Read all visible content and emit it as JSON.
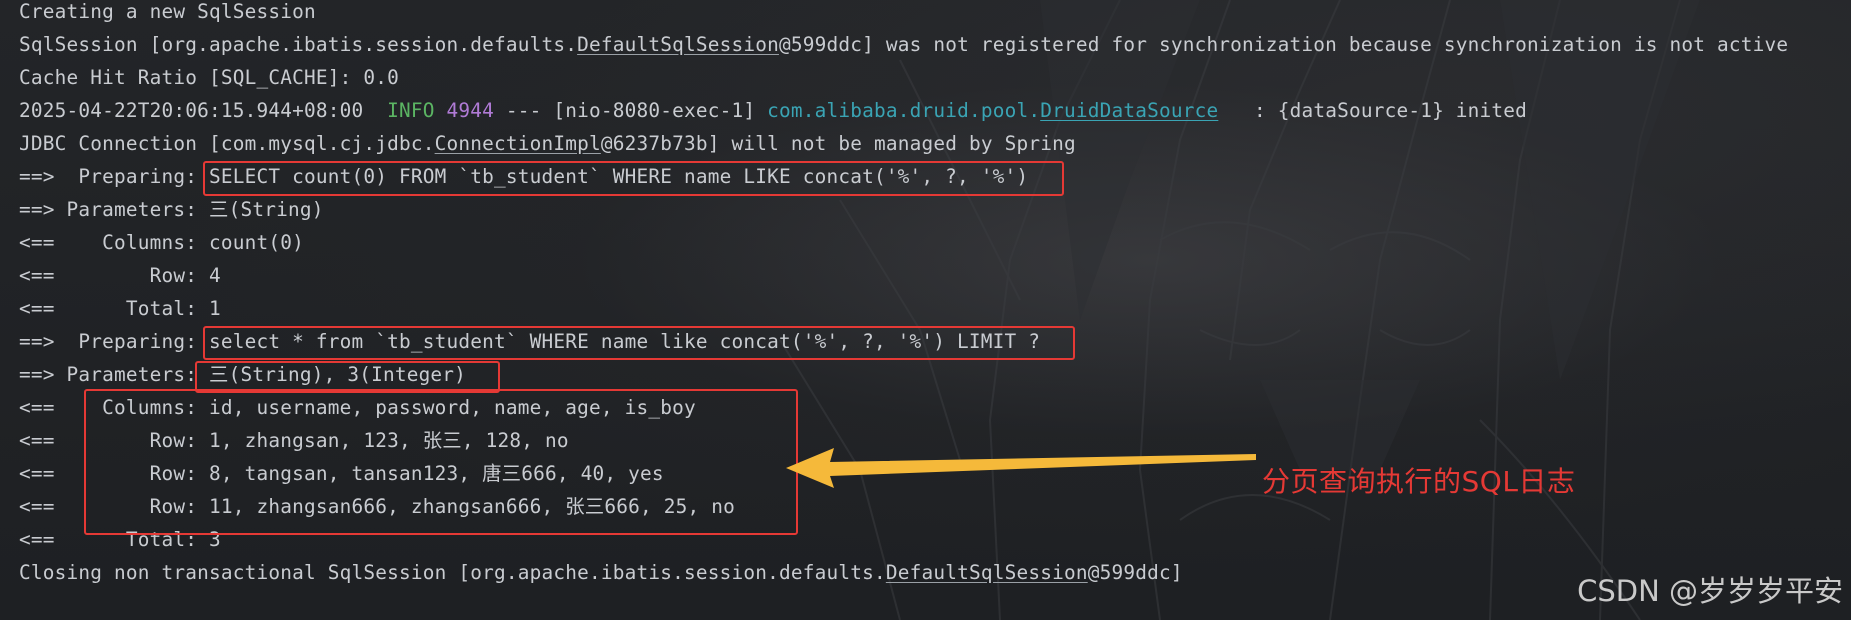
{
  "colors": {
    "background": "#1f2124",
    "text": "#c9ccd1",
    "info": "#5bb563",
    "pid": "#b07bd6",
    "logger": "#3aa4b4",
    "highlight_box": "#e53935",
    "arrow": "#f5b93a",
    "annotation": "#e53935"
  },
  "log": {
    "l1": "Creating a new SqlSession",
    "l2_a": "SqlSession [org.apache.ibatis.session.defaults.",
    "l2_b": "DefaultSqlSession",
    "l2_c": "@599ddc] was not registered for synchronization because synchronization is not active",
    "l3": "Cache Hit Ratio [SQL_CACHE]: 0.0",
    "l4_ts": "2025-04-22T20:06:15.944+08:00  ",
    "l4_level": "INFO",
    "l4_pid": "4944",
    "l4_mid": " --- [nio-8080-exec-1] ",
    "l4_logger_a": "com.alibaba.druid.pool.",
    "l4_logger_b": "DruidDataSource",
    "l4_msg": "   : {dataSource-1} inited",
    "l5_a": "JDBC Connection [com.mysql.cj.jdbc.",
    "l5_b": "ConnectionImpl",
    "l5_c": "@6237b73b] will not be managed by Spring",
    "l6": "==>  Preparing: SELECT count(0) FROM `tb_student` WHERE name LIKE concat('%', ?, '%')",
    "l7": "==> Parameters: 三(String)",
    "l8": "<==    Columns: count(0)",
    "l9": "<==        Row: 4",
    "l10": "<==      Total: 1",
    "l11": "==>  Preparing: select * from `tb_student` WHERE name like concat('%', ?, '%') LIMIT ?",
    "l12": "==> Parameters: 三(String), 3(Integer)",
    "l13": "<==    Columns: id, username, password, name, age, is_boy",
    "l14": "<==        Row: 1, zhangsan, 123, 张三, 128, no",
    "l15": "<==        Row: 8, tangsan, tansan123, 唐三666, 40, yes",
    "l16": "<==        Row: 11, zhangsan666, zhangsan666, 张三666, 25, no",
    "l17": "<==      Total: 3",
    "l18_a": "Closing non transactional SqlSession [org.apache.ibatis.session.defaults.",
    "l18_b": "DefaultSqlSession",
    "l18_c": "@599ddc]"
  },
  "annotation": "分页查询执行的SQL日志",
  "watermark": "CSDN @岁岁岁平安"
}
